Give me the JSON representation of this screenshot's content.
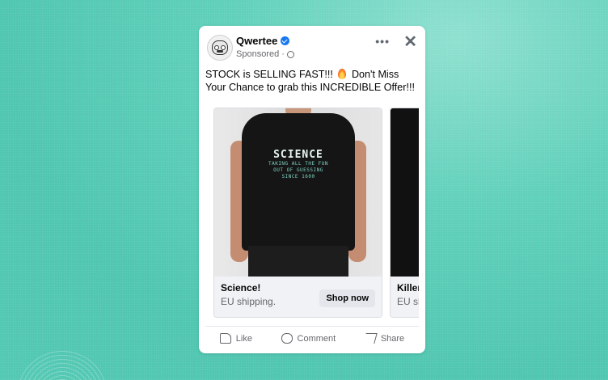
{
  "post": {
    "page_name": "Qwertee",
    "sponsored_label": "Sponsored",
    "caption_part1": "STOCK is SELLING FAST!!!",
    "caption_part2": "Don't Miss Your Chance to grab this INCREDIBLE Offer!!!"
  },
  "carousel": {
    "items": [
      {
        "title": "Science!",
        "subtitle": "EU shipping.",
        "button": "Shop now",
        "shirt_print_title": "SCIENCE",
        "shirt_print_lines": [
          "TAKING ALL THE FUN",
          "OUT OF GUESSING",
          "SINCE 1600"
        ]
      },
      {
        "title": "Killer",
        "subtitle": "EU sh"
      }
    ]
  },
  "actions": {
    "like": "Like",
    "comment": "Comment",
    "share": "Share"
  },
  "colors": {
    "background": "#5fd0ba",
    "verified": "#1877f2",
    "print_accent": "#7fd3c4"
  }
}
